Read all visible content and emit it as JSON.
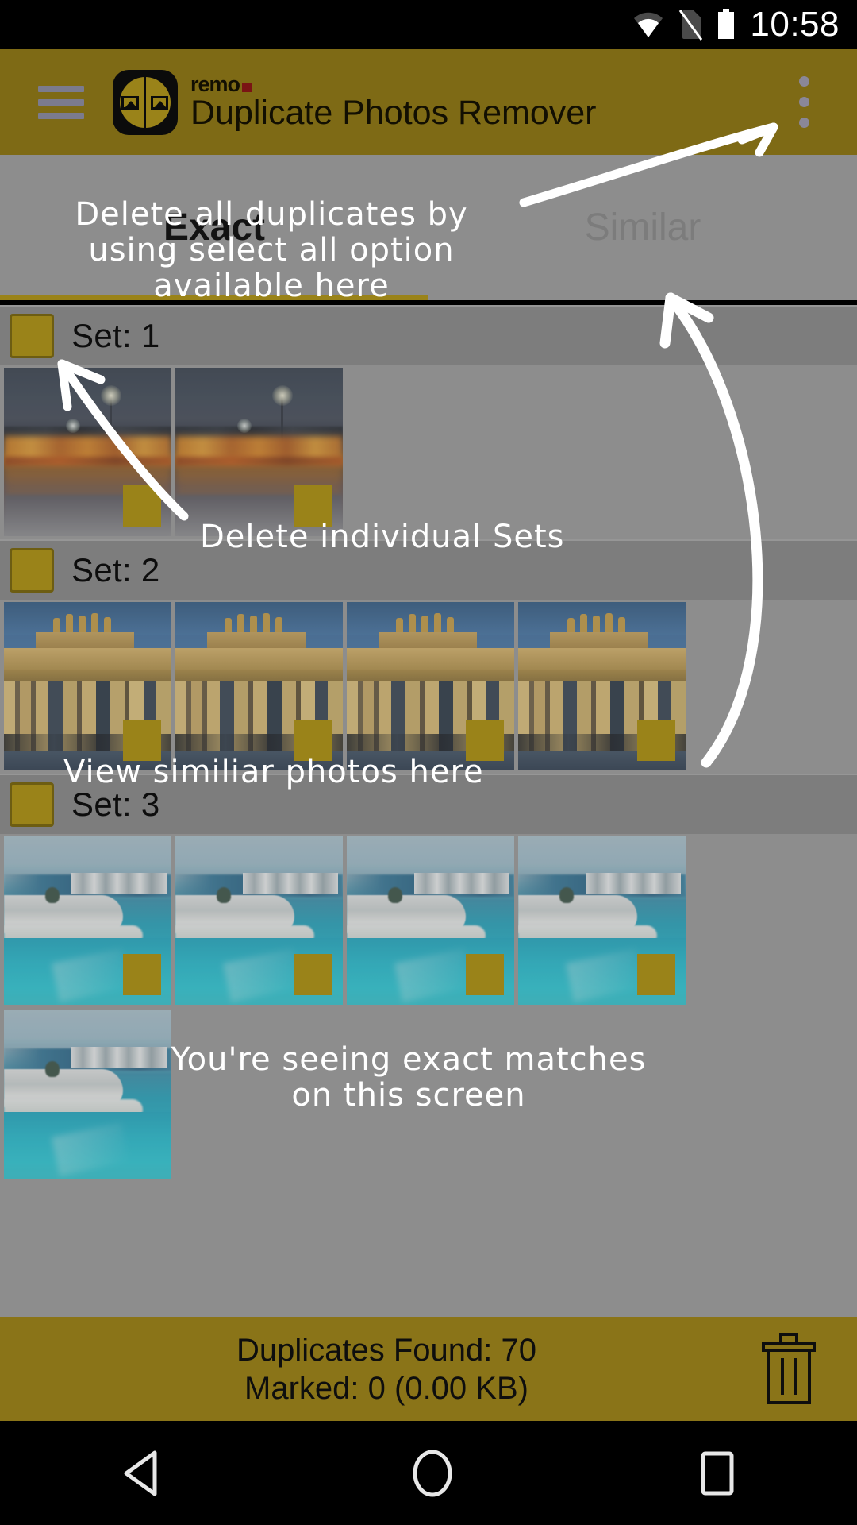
{
  "status_bar": {
    "time": "10:58",
    "icons": [
      "wifi-icon",
      "no-sim-icon",
      "battery-full-icon"
    ]
  },
  "app_bar": {
    "menu_icon": "hamburger-menu-icon",
    "logo_icon": "duplicate-photos-app-icon",
    "brand": "remo",
    "title": "Duplicate Photos Remover",
    "overflow_icon": "overflow-menu-icon",
    "background_color": "#7e6a15"
  },
  "tabs": [
    {
      "label": "Exact",
      "active": true
    },
    {
      "label": "Similar",
      "active": false
    }
  ],
  "sets": [
    {
      "label": "Set: 1",
      "checkbox_checked": false,
      "thumbs": [
        {
          "scene": "sc-night",
          "name": "night-harbour-photo",
          "marked": false
        },
        {
          "scene": "sc-night",
          "name": "night-harbour-photo",
          "marked": false
        }
      ]
    },
    {
      "label": "Set: 2",
      "checkbox_checked": false,
      "thumbs": [
        {
          "scene": "sc-gate",
          "name": "brandenburg-gate-photo",
          "marked": false
        },
        {
          "scene": "sc-gate",
          "name": "brandenburg-gate-photo",
          "marked": false
        },
        {
          "scene": "sc-gate",
          "name": "brandenburg-gate-photo",
          "marked": false
        },
        {
          "scene": "sc-gate",
          "name": "brandenburg-gate-photo",
          "marked": false
        }
      ]
    },
    {
      "label": "Set: 3",
      "checkbox_checked": false,
      "thumbs": [
        {
          "scene": "sc-sea",
          "name": "tropical-resort-photo",
          "marked": false
        },
        {
          "scene": "sc-sea",
          "name": "tropical-resort-photo",
          "marked": false
        },
        {
          "scene": "sc-sea",
          "name": "tropical-resort-photo",
          "marked": false
        },
        {
          "scene": "sc-sea",
          "name": "tropical-resort-photo",
          "marked": false
        }
      ]
    },
    {
      "label": "",
      "partial": true,
      "thumbs": [
        {
          "scene": "sc-sea",
          "name": "tropical-resort-photo",
          "marked": false
        }
      ]
    }
  ],
  "bottom_bar": {
    "duplicates_found": "Duplicates Found: 70",
    "marked": "Marked: 0 (0.00 KB)",
    "delete_icon": "trash-can-icon",
    "background_color": "#8a7418"
  },
  "nav_bar": {
    "back_icon": "back-triangle-icon",
    "home_icon": "home-circle-icon",
    "recents_icon": "recents-square-icon"
  },
  "annotations": [
    {
      "id": "a1",
      "text": "Delete  all  duplicates  by\nusing  select  all  option\navailable  here"
    },
    {
      "id": "a2",
      "text": "Delete  individual  Sets"
    },
    {
      "id": "a3",
      "text": "View  similiar  photos  here"
    },
    {
      "id": "a4",
      "text": "You're  seeing  exact  matches\non  this  screen"
    }
  ],
  "colors": {
    "accent_gold": "#9a8319",
    "app_bar": "#7e6a15",
    "list_bg": "#8d8d8d",
    "set_header_bg": "#7d7d7d"
  }
}
